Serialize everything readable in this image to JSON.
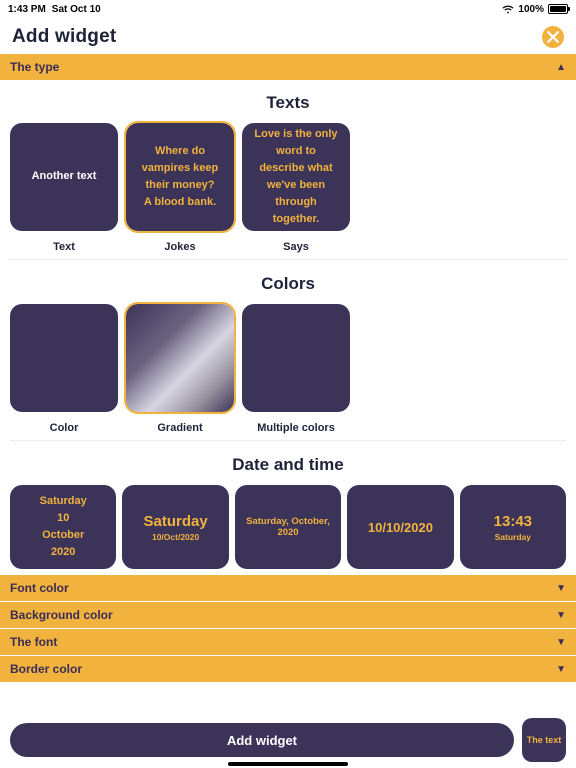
{
  "status": {
    "time": "1:43 PM",
    "date": "Sat Oct 10",
    "battery": "100%"
  },
  "header": {
    "title": "Add widget"
  },
  "accordionTop": {
    "label": "The type"
  },
  "texts": {
    "section_title": "Texts",
    "tiles": [
      {
        "content": "Another text",
        "label": "Text"
      },
      {
        "content": "Where do vampires keep their money?\nA blood bank.",
        "label": "Jokes"
      },
      {
        "content": "Love is the only word to describe what we've been through together.",
        "label": "Says"
      }
    ]
  },
  "colors": {
    "section_title": "Colors",
    "tiles": [
      {
        "label": "Color"
      },
      {
        "label": "Gradient"
      },
      {
        "label": "Multiple colors",
        "swatches": [
          "#1b315f",
          "#2f4a3e",
          "#3c3358",
          "#5d2f45",
          "#2a2a36"
        ]
      }
    ]
  },
  "datetime": {
    "section_title": "Date and time",
    "tiles": [
      {
        "lines": [
          "Saturday",
          "10",
          "October",
          "2020"
        ]
      },
      {
        "big": "Saturday",
        "small": "10/Oct/2020"
      },
      {
        "mid": "Saturday, October, 2020"
      },
      {
        "big": "10/10/2020"
      },
      {
        "big": "13:43",
        "small": "Saturday"
      }
    ]
  },
  "accordions": [
    {
      "label": "Font color"
    },
    {
      "label": "Background color"
    },
    {
      "label": "The font"
    },
    {
      "label": "Border color"
    }
  ],
  "footer": {
    "button": "Add widget",
    "preview": "The text"
  }
}
